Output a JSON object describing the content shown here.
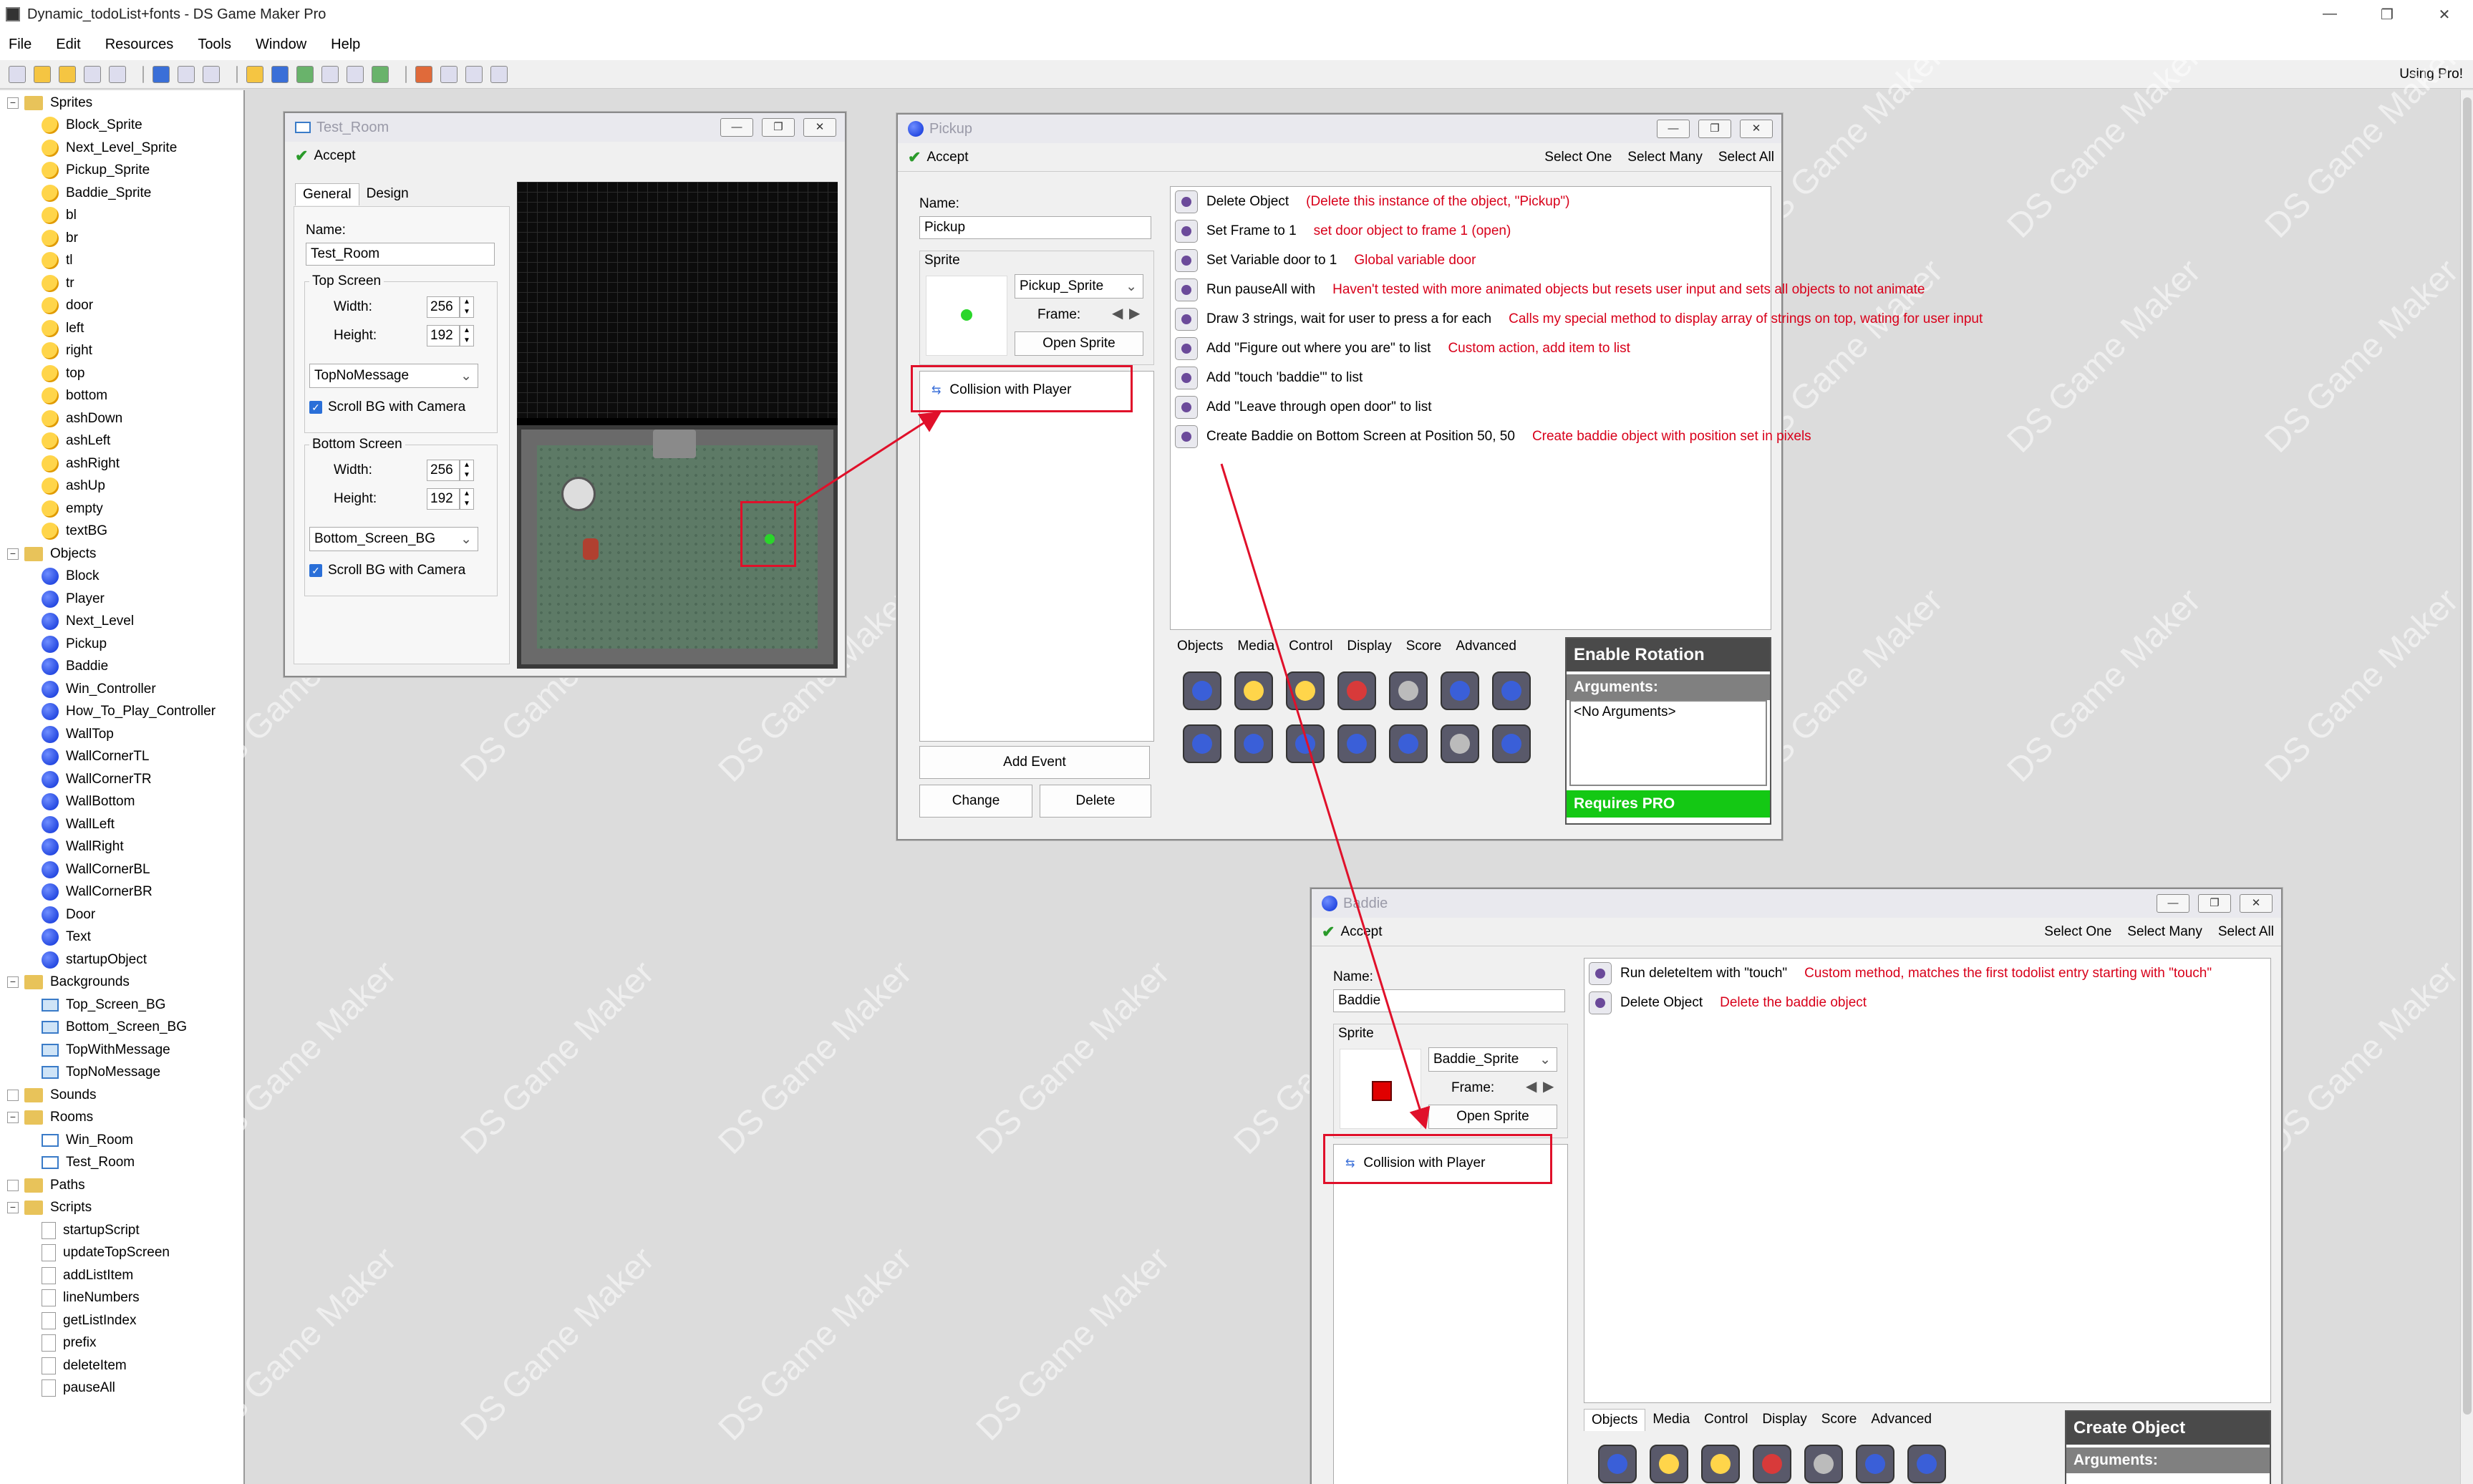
{
  "app": {
    "title": "Dynamic_todoList+fonts - DS Game Maker Pro",
    "using_pro": "Using Pro!"
  },
  "window_controls": {
    "minimize": "—",
    "restore": "❐",
    "close": "✕"
  },
  "menu": [
    "File",
    "Edit",
    "Resources",
    "Tools",
    "Window",
    "Help"
  ],
  "tree": [
    {
      "type": "folder",
      "label": "Sprites",
      "level": 0
    },
    {
      "type": "spr",
      "label": "Block_Sprite",
      "level": 1
    },
    {
      "type": "spr",
      "label": "Next_Level_Sprite",
      "level": 1
    },
    {
      "type": "spr",
      "label": "Pickup_Sprite",
      "level": 1
    },
    {
      "type": "spr",
      "label": "Baddie_Sprite",
      "level": 1
    },
    {
      "type": "spr",
      "label": "bl",
      "level": 1
    },
    {
      "type": "spr",
      "label": "br",
      "level": 1
    },
    {
      "type": "spr",
      "label": "tl",
      "level": 1
    },
    {
      "type": "spr",
      "label": "tr",
      "level": 1
    },
    {
      "type": "spr",
      "label": "door",
      "level": 1
    },
    {
      "type": "spr",
      "label": "left",
      "level": 1
    },
    {
      "type": "spr",
      "label": "right",
      "level": 1
    },
    {
      "type": "spr",
      "label": "top",
      "level": 1
    },
    {
      "type": "spr",
      "label": "bottom",
      "level": 1
    },
    {
      "type": "spr",
      "label": "ashDown",
      "level": 1
    },
    {
      "type": "spr",
      "label": "ashLeft",
      "level": 1
    },
    {
      "type": "spr",
      "label": "ashRight",
      "level": 1
    },
    {
      "type": "spr",
      "label": "ashUp",
      "level": 1
    },
    {
      "type": "spr",
      "label": "empty",
      "level": 1
    },
    {
      "type": "spr",
      "label": "textBG",
      "level": 1
    },
    {
      "type": "folder",
      "label": "Objects",
      "level": 0
    },
    {
      "type": "obj",
      "label": "Block",
      "level": 1
    },
    {
      "type": "obj",
      "label": "Player",
      "level": 1
    },
    {
      "type": "obj",
      "label": "Next_Level",
      "level": 1
    },
    {
      "type": "obj",
      "label": "Pickup",
      "level": 1
    },
    {
      "type": "obj",
      "label": "Baddie",
      "level": 1
    },
    {
      "type": "obj",
      "label": "Win_Controller",
      "level": 1
    },
    {
      "type": "obj",
      "label": "How_To_Play_Controller",
      "level": 1
    },
    {
      "type": "obj",
      "label": "WallTop",
      "level": 1
    },
    {
      "type": "obj",
      "label": "WallCornerTL",
      "level": 1
    },
    {
      "type": "obj",
      "label": "WallCornerTR",
      "level": 1
    },
    {
      "type": "obj",
      "label": "WallBottom",
      "level": 1
    },
    {
      "type": "obj",
      "label": "WallLeft",
      "level": 1
    },
    {
      "type": "obj",
      "label": "WallRight",
      "level": 1
    },
    {
      "type": "obj",
      "label": "WallCornerBL",
      "level": 1
    },
    {
      "type": "obj",
      "label": "WallCornerBR",
      "level": 1
    },
    {
      "type": "obj",
      "label": "Door",
      "level": 1
    },
    {
      "type": "obj",
      "label": "Text",
      "level": 1
    },
    {
      "type": "obj",
      "label": "startupObject",
      "level": 1
    },
    {
      "type": "folder",
      "label": "Backgrounds",
      "level": 0
    },
    {
      "type": "bg",
      "label": "Top_Screen_BG",
      "level": 1
    },
    {
      "type": "bg",
      "label": "Bottom_Screen_BG",
      "level": 1
    },
    {
      "type": "bg",
      "label": "TopWithMessage",
      "level": 1
    },
    {
      "type": "bg",
      "label": "TopNoMessage",
      "level": 1
    },
    {
      "type": "folder",
      "label": "Sounds",
      "level": 0
    },
    {
      "type": "folder",
      "label": "Rooms",
      "level": 0
    },
    {
      "type": "rm",
      "label": "Win_Room",
      "level": 1
    },
    {
      "type": "rm",
      "label": "Test_Room",
      "level": 1
    },
    {
      "type": "folder",
      "label": "Paths",
      "level": 0
    },
    {
      "type": "folder",
      "label": "Scripts",
      "level": 0
    },
    {
      "type": "sc",
      "label": "startupScript",
      "level": 1
    },
    {
      "type": "sc",
      "label": "updateTopScreen",
      "level": 1
    },
    {
      "type": "sc",
      "label": "addListItem",
      "level": 1
    },
    {
      "type": "sc",
      "label": "lineNumbers",
      "level": 1
    },
    {
      "type": "sc",
      "label": "getListIndex",
      "level": 1
    },
    {
      "type": "sc",
      "label": "prefix",
      "level": 1
    },
    {
      "type": "sc",
      "label": "deleteItem",
      "level": 1
    },
    {
      "type": "sc",
      "label": "pauseAll",
      "level": 1
    }
  ],
  "room_window": {
    "title": "Test_Room",
    "accept": "Accept",
    "tabs": [
      "General",
      "Design"
    ],
    "name_label": "Name:",
    "name_value": "Test_Room",
    "top_screen": {
      "legend": "Top Screen",
      "width_label": "Width:",
      "width": "256",
      "height_label": "Height:",
      "height": "192",
      "bg": "TopNoMessage",
      "scroll": "Scroll BG with Camera"
    },
    "bottom_screen": {
      "legend": "Bottom Screen",
      "width_label": "Width:",
      "width": "256",
      "height_label": "Height:",
      "height": "192",
      "bg": "Bottom_Screen_BG",
      "scroll": "Scroll BG with Camera"
    }
  },
  "pickup_window": {
    "title": "Pickup",
    "accept": "Accept",
    "select_one": "Select One",
    "select_many": "Select Many",
    "select_all": "Select All",
    "name_label": "Name:",
    "name_value": "Pickup",
    "sprite_legend": "Sprite",
    "sprite": "Pickup_Sprite",
    "frame_label": "Frame:",
    "open_sprite": "Open Sprite",
    "event": "Collision with Player",
    "add_event": "Add Event",
    "change": "Change",
    "delete": "Delete",
    "actions": [
      {
        "label": "Delete Object",
        "note": "(Delete this instance of the object, \"Pickup\")"
      },
      {
        "label": "Set Frame to 1",
        "note": "set door object to frame 1 (open)"
      },
      {
        "label": "Set Variable door to 1",
        "note": "Global variable door"
      },
      {
        "label": "Run pauseAll with",
        "note": "Haven't tested with more animated objects but resets user input and sets all objects to not animate"
      },
      {
        "label": "Draw 3 strings, wait for user to press a for each",
        "note": "Calls my special method to display array of strings on top, wating for user input"
      },
      {
        "label": "Add \"Figure out where you are\" to list",
        "note": "Custom action, add item to list"
      },
      {
        "label": "Add \"touch 'baddie'\" to list",
        "note": ""
      },
      {
        "label": "Add \"Leave through open door\" to list",
        "note": ""
      },
      {
        "label": "Create Baddie on Bottom Screen at Position 50, 50",
        "note": "Create baddie object with position set in pixels"
      }
    ],
    "palette_tabs": [
      "Objects",
      "Media",
      "Control",
      "Display",
      "Score",
      "Advanced"
    ],
    "info_title": "Enable Rotation",
    "arguments_label": "Arguments:",
    "arguments_value": "<No Arguments>",
    "requires_pro": "Requires PRO"
  },
  "baddie_window": {
    "title": "Baddie",
    "accept": "Accept",
    "select_one": "Select One",
    "select_many": "Select Many",
    "select_all": "Select All",
    "name_label": "Name:",
    "name_value": "Baddie",
    "sprite_legend": "Sprite",
    "sprite": "Baddie_Sprite",
    "frame_label": "Frame:",
    "open_sprite": "Open Sprite",
    "event": "Collision with Player",
    "actions": [
      {
        "label": "Run deleteItem with \"touch\"",
        "note": "Custom method, matches the first todolist entry starting with \"touch\""
      },
      {
        "label": "Delete Object",
        "note": "Delete the baddie object"
      }
    ],
    "palette_tabs": [
      "Objects",
      "Media",
      "Control",
      "Display",
      "Score",
      "Advanced"
    ],
    "info_title": "Create Object",
    "arguments_label": "Arguments:"
  },
  "watermark": "DS Game Maker",
  "colors": {
    "annotation_red": "#e0102a",
    "requires_pro_green": "#14c814"
  }
}
